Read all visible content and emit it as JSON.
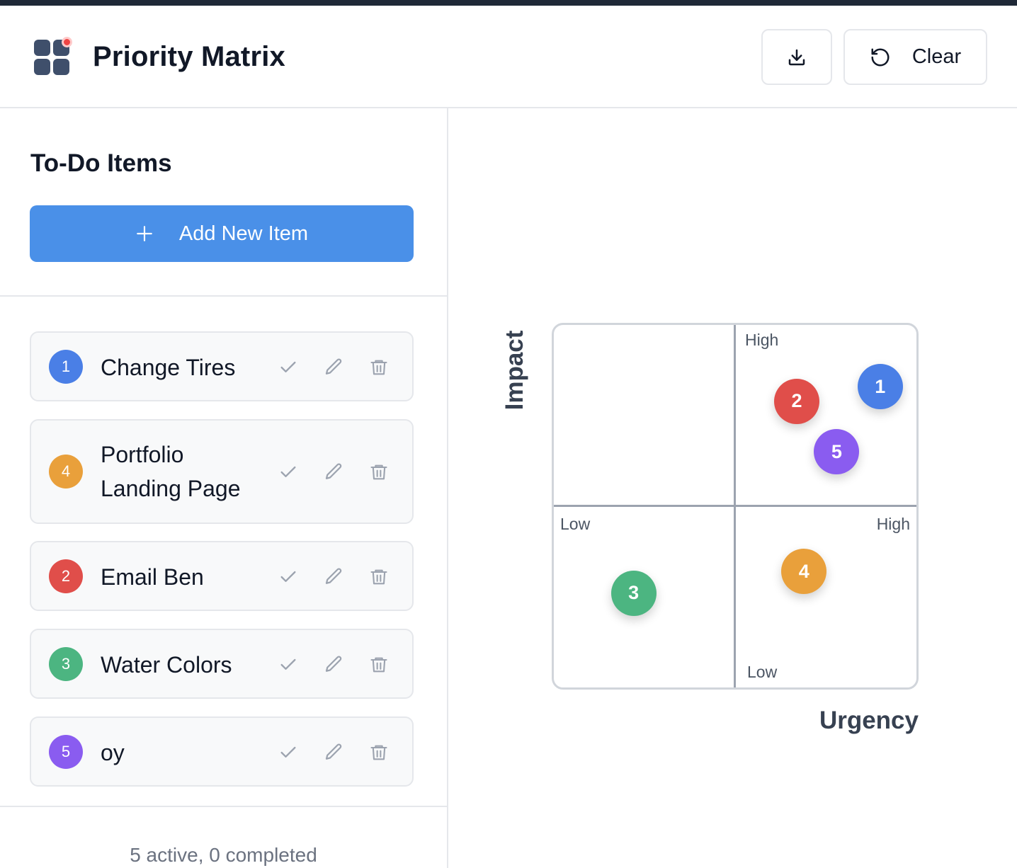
{
  "app": {
    "title": "Priority Matrix"
  },
  "toolbar": {
    "download_icon": "download-icon",
    "clear_label": "Clear",
    "clear_icon": "rotate-ccw-icon"
  },
  "sidebar": {
    "title": "To-Do Items",
    "add_button_label": "Add New Item",
    "items": [
      {
        "number": "1",
        "label": "Change Tires",
        "color": "#4a7fe6"
      },
      {
        "number": "4",
        "label": "Portfolio Landing Page",
        "color": "#e9a03b"
      },
      {
        "number": "2",
        "label": "Email Ben",
        "color": "#e04e4a"
      },
      {
        "number": "3",
        "label": "Water Colors",
        "color": "#4cb581"
      },
      {
        "number": "5",
        "label": "oy",
        "color": "#8a5cf0"
      }
    ],
    "footer": "5 active, 0 completed"
  },
  "matrix": {
    "y_axis_label": "Impact",
    "x_axis_label": "Urgency",
    "ticks": {
      "impact_high": "High",
      "impact_low": "Low",
      "urgency_low": "Low",
      "urgency_high": "High"
    },
    "markers": [
      {
        "number": "1",
        "color": "#4a7fe6",
        "urgency": 0.9,
        "impact": 0.83
      },
      {
        "number": "2",
        "color": "#e04e4a",
        "urgency": 0.67,
        "impact": 0.79
      },
      {
        "number": "5",
        "color": "#8a5cf0",
        "urgency": 0.78,
        "impact": 0.65
      },
      {
        "number": "4",
        "color": "#e9a03b",
        "urgency": 0.69,
        "impact": 0.32
      },
      {
        "number": "3",
        "color": "#4cb581",
        "urgency": 0.22,
        "impact": 0.26
      }
    ]
  },
  "icons": {
    "check": "check-icon",
    "edit": "pencil-icon",
    "delete": "trash-icon",
    "add": "plus-icon",
    "logo": "grid-logo-icon"
  }
}
